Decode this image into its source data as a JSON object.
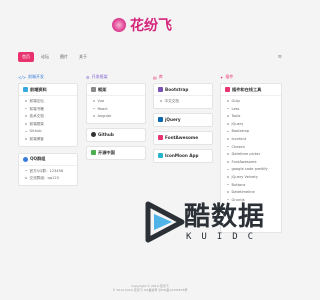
{
  "brand": {
    "title": "花纷飞"
  },
  "nav": {
    "items": [
      "首页",
      "论坛",
      "图片",
      "关于"
    ],
    "right_icon": "≡"
  },
  "columns": [
    {
      "title": "前端开发",
      "cards": [
        {
          "title": "前端资料",
          "color": "#3aa8e0",
          "items": [
            "前端论坛",
            "前端书籍",
            "技术文档",
            "前端框架",
            "Github",
            "前端博客"
          ]
        },
        {
          "title": "QQ群组",
          "color": "#3b7ddd",
          "items": [
            "官方QQ群：123456",
            "交流群组：qq123"
          ]
        }
      ]
    },
    {
      "title": "开发框架",
      "cards": [
        {
          "title": "框架",
          "color": "#8a8a8a",
          "items": [
            "Vue",
            "React",
            "Angular"
          ]
        },
        {
          "title": "Github",
          "color": "#333333",
          "items": []
        },
        {
          "title": "开源中国",
          "color": "#4caf50",
          "items": []
        }
      ]
    },
    {
      "title": "库",
      "cards": [
        {
          "title": "Bootstrap",
          "color": "#7952b3",
          "items": [
            "中文文档"
          ]
        },
        {
          "title": "jQuery",
          "color": "#0769ad",
          "items": []
        },
        {
          "title": "FontAwesome",
          "color": "#e8336f",
          "items": []
        },
        {
          "title": "IconMoon App",
          "color": "#25b3ce",
          "items": []
        }
      ]
    },
    {
      "title": "插件",
      "cards": [
        {
          "title": "插件和在线工具",
          "color": "#e8336f",
          "items": [
            "Gulp",
            "Less",
            "Tools",
            "jQuery",
            "Bootstrap",
            "Iconfont",
            "Chosen",
            "Datetime picker",
            "FontAwesome",
            "google code prettify",
            "jQuery Velvety",
            "Buttons",
            "Datetimeline",
            "Gruntjs"
          ]
        }
      ]
    }
  ],
  "footer": {
    "line1": "Copyright © 2019 花纷飞",
    "line2": "© 2014-2019 花纷飞 ICP备案号 沪ICP备12345678号"
  },
  "watermark": {
    "text": "酷数据",
    "sub": "KUIDC"
  }
}
